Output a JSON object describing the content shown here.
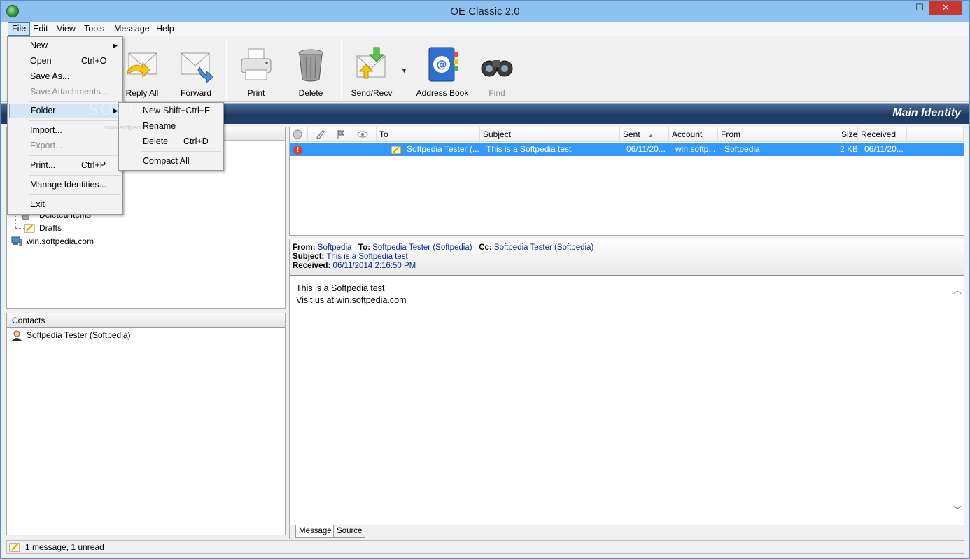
{
  "window": {
    "title": "OE Classic 2.0",
    "min_glyph": "—",
    "max_glyph": "☐",
    "close_glyph": "✕"
  },
  "menubar": {
    "items": [
      "File",
      "Edit",
      "View",
      "Tools",
      "Message",
      "Help"
    ]
  },
  "toolbar": {
    "reply_all": "Reply All",
    "forward": "Forward",
    "print": "Print",
    "delete": "Delete",
    "send_recv": "Send/Recv",
    "address_book": "Address Book",
    "find": "Find",
    "dropdown_glyph": "▼"
  },
  "identity": {
    "name": "Main Identity"
  },
  "folders": {
    "deleted_items": "Deleted Items",
    "drafts": "Drafts",
    "account": "win.softpedia.com"
  },
  "contacts": {
    "header": "Contacts",
    "items": [
      "Softpedia Tester (Softpedia)"
    ]
  },
  "message_list": {
    "columns": {
      "to": "To",
      "subject": "Subject",
      "sent": "Sent",
      "sort_glyph": "▲",
      "account": "Account",
      "from": "From",
      "size": "Size",
      "received": "Received"
    },
    "rows": [
      {
        "priority_glyph": "!",
        "to": "Softpedia Tester (...",
        "subject": "This is a Softpedia test",
        "sent": "06/11/20...",
        "account": "win.softp...",
        "from": "Softpedia",
        "size": "2 KB",
        "received": "06/11/20..."
      }
    ]
  },
  "preview": {
    "from_label": "From:",
    "from": "Softpedia",
    "to_label": "To:",
    "to": "Softpedia Tester (Softpedia)",
    "cc_label": "Cc:",
    "cc": "Softpedia Tester (Softpedia)",
    "subject_label": "Subject:",
    "subject": "This is a Softpedia test",
    "received_label": "Received:",
    "received": "06/11/2014 2:16:50 PM",
    "body_line1": "This is a Softpedia test",
    "body_line2": "Visit us at win.softpedia.com",
    "tabs": [
      "Message",
      "Source"
    ],
    "scroll_up_glyph": "︿",
    "scroll_down_glyph": "﹀"
  },
  "status": {
    "text": "1 message, 1 unread"
  },
  "file_menu": {
    "new": "New",
    "submenu_glyph": "▶",
    "open": "Open",
    "open_sc": "Ctrl+O",
    "save_as": "Save As...",
    "save_attachments": "Save Attachments...",
    "folder": "Folder",
    "import": "Import...",
    "export": "Export...",
    "print": "Print...",
    "print_sc": "Ctrl+P",
    "manage_identities": "Manage Identities...",
    "exit": "Exit"
  },
  "folder_submenu": {
    "new": "New",
    "new_sc": "Shift+Ctrl+E",
    "rename": "Rename",
    "delete": "Delete",
    "delete_sc": "Ctrl+D",
    "compact_all": "Compact All"
  },
  "watermark": {
    "big": "SOFTPEDIA",
    "small": "www.softpedia.com"
  },
  "colors": {
    "selection": "#3399ff",
    "identity_bar": "#1d3a63",
    "title_bar": "#8ec1ef",
    "close_button": "#c7372f"
  }
}
